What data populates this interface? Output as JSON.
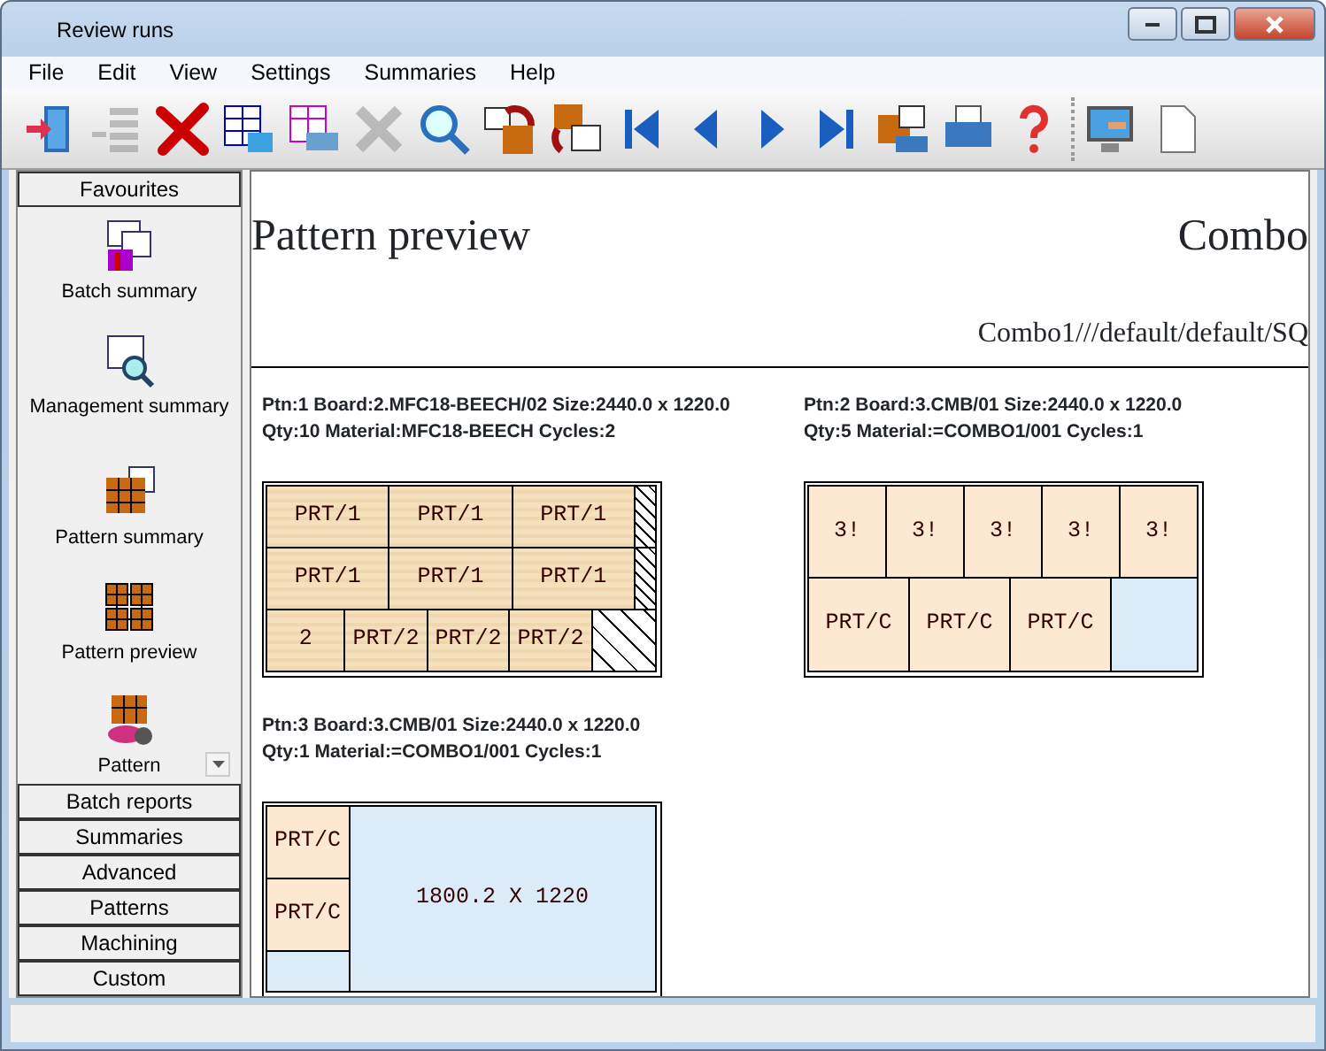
{
  "window": {
    "title": "Review runs"
  },
  "menu": [
    "File",
    "Edit",
    "View",
    "Settings",
    "Summaries",
    "Help"
  ],
  "toolbar": [
    {
      "kind": "exit",
      "disabled": false
    },
    {
      "kind": "list",
      "disabled": true
    },
    {
      "kind": "delete",
      "disabled": false
    },
    {
      "kind": "table",
      "disabled": false
    },
    {
      "kind": "table-print",
      "disabled": false
    },
    {
      "kind": "tools",
      "disabled": true
    },
    {
      "kind": "search",
      "disabled": false
    },
    {
      "kind": "rotate",
      "disabled": false
    },
    {
      "kind": "rotate-back",
      "disabled": false
    },
    {
      "kind": "first",
      "disabled": false
    },
    {
      "kind": "prev",
      "disabled": false
    },
    {
      "kind": "next",
      "disabled": false
    },
    {
      "kind": "last",
      "disabled": false
    },
    {
      "kind": "pattern-print",
      "disabled": false
    },
    {
      "kind": "print",
      "disabled": false
    },
    {
      "kind": "help",
      "disabled": false
    },
    {
      "kind": "separator"
    },
    {
      "kind": "monitor",
      "disabled": false
    },
    {
      "kind": "page",
      "disabled": false
    }
  ],
  "sidebar": {
    "header": "Favourites",
    "items": [
      {
        "kind": "batch",
        "label": "Batch summary"
      },
      {
        "kind": "management",
        "label": "Management summary"
      },
      {
        "kind": "pattern",
        "label": "Pattern summary"
      },
      {
        "kind": "preview",
        "label": "Pattern preview"
      },
      {
        "kind": "machining",
        "label": "Pattern"
      }
    ],
    "sections": [
      "Batch reports",
      "Summaries",
      "Advanced",
      "Patterns",
      "Machining",
      "Custom"
    ]
  },
  "preview": {
    "title": "Pattern preview",
    "title_right": "Combo",
    "subtitle": "Combo1///default/default/SQ",
    "patterns": [
      {
        "info": [
          "Ptn:1  Board:2.MFC18-BEECH/02  Size:2440.0 x 1220.0",
          "Qty:10  Material:MFC18-BEECH  Cycles:2"
        ],
        "grain": true,
        "kind": "rows",
        "strips": [
          [
            {
              "kind": "part",
              "label": "PRT/1"
            },
            {
              "kind": "part",
              "label": "PRT/1"
            },
            {
              "kind": "part",
              "label": "PRT/1"
            },
            {
              "kind": "trim"
            }
          ],
          [
            {
              "kind": "part",
              "label": "PRT/1"
            },
            {
              "kind": "part",
              "label": "PRT/1"
            },
            {
              "kind": "part",
              "label": "PRT/1"
            },
            {
              "kind": "trim"
            }
          ],
          [
            {
              "kind": "part",
              "label": "2"
            },
            {
              "kind": "part",
              "label": "PRT/2"
            },
            {
              "kind": "part",
              "label": "PRT/2"
            },
            {
              "kind": "part",
              "label": "PRT/2"
            },
            {
              "kind": "waste"
            }
          ]
        ]
      },
      {
        "info": [
          "Ptn:2  Board:3.CMB/01  Size:2440.0 x 1220.0",
          "Qty:5  Material:=COMBO1/001  Cycles:1"
        ],
        "grain": false,
        "kind": "rows",
        "strips": [
          [
            {
              "kind": "part",
              "label": "3!"
            },
            {
              "kind": "part",
              "label": "3!"
            },
            {
              "kind": "part",
              "label": "3!"
            },
            {
              "kind": "part",
              "label": "3!"
            },
            {
              "kind": "part",
              "label": "3!"
            }
          ],
          [
            {
              "kind": "part",
              "label": "PRT/C"
            },
            {
              "kind": "part",
              "label": "PRT/C"
            },
            {
              "kind": "part",
              "label": "PRT/C"
            },
            {
              "kind": "offcut"
            }
          ]
        ]
      },
      {
        "info": [
          "Ptn:3  Board:3.CMB/01  Size:2440.0 x 1220.0",
          "Qty:1  Material:=COMBO1/001  Cycles:1"
        ],
        "grain": false,
        "kind": "columns",
        "strips": [
          [
            {
              "kind": "part",
              "label": "PRT/C"
            },
            {
              "kind": "part",
              "label": "PRT/C"
            },
            {
              "kind": "offcut"
            }
          ],
          [
            {
              "kind": "offcut",
              "label": "1800.2 X 1220"
            }
          ]
        ]
      }
    ]
  }
}
